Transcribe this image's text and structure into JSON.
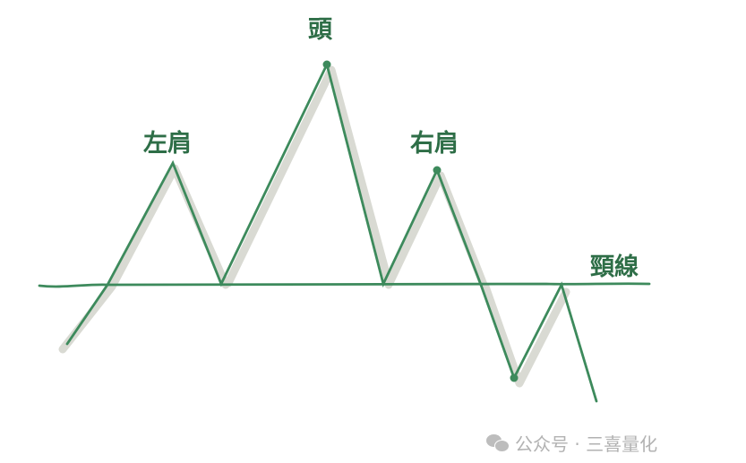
{
  "labels": {
    "head": "頭",
    "left_shoulder": "左肩",
    "right_shoulder": "右肩",
    "neckline": "頸線"
  },
  "watermark": {
    "text": "公众号 · 三喜量化",
    "icon": "wechat-icon"
  },
  "colors": {
    "line": "#3d8a5c",
    "shadow": "#d9dad3",
    "label": "#2e6e47",
    "watermark": "#b2b2b2"
  }
}
